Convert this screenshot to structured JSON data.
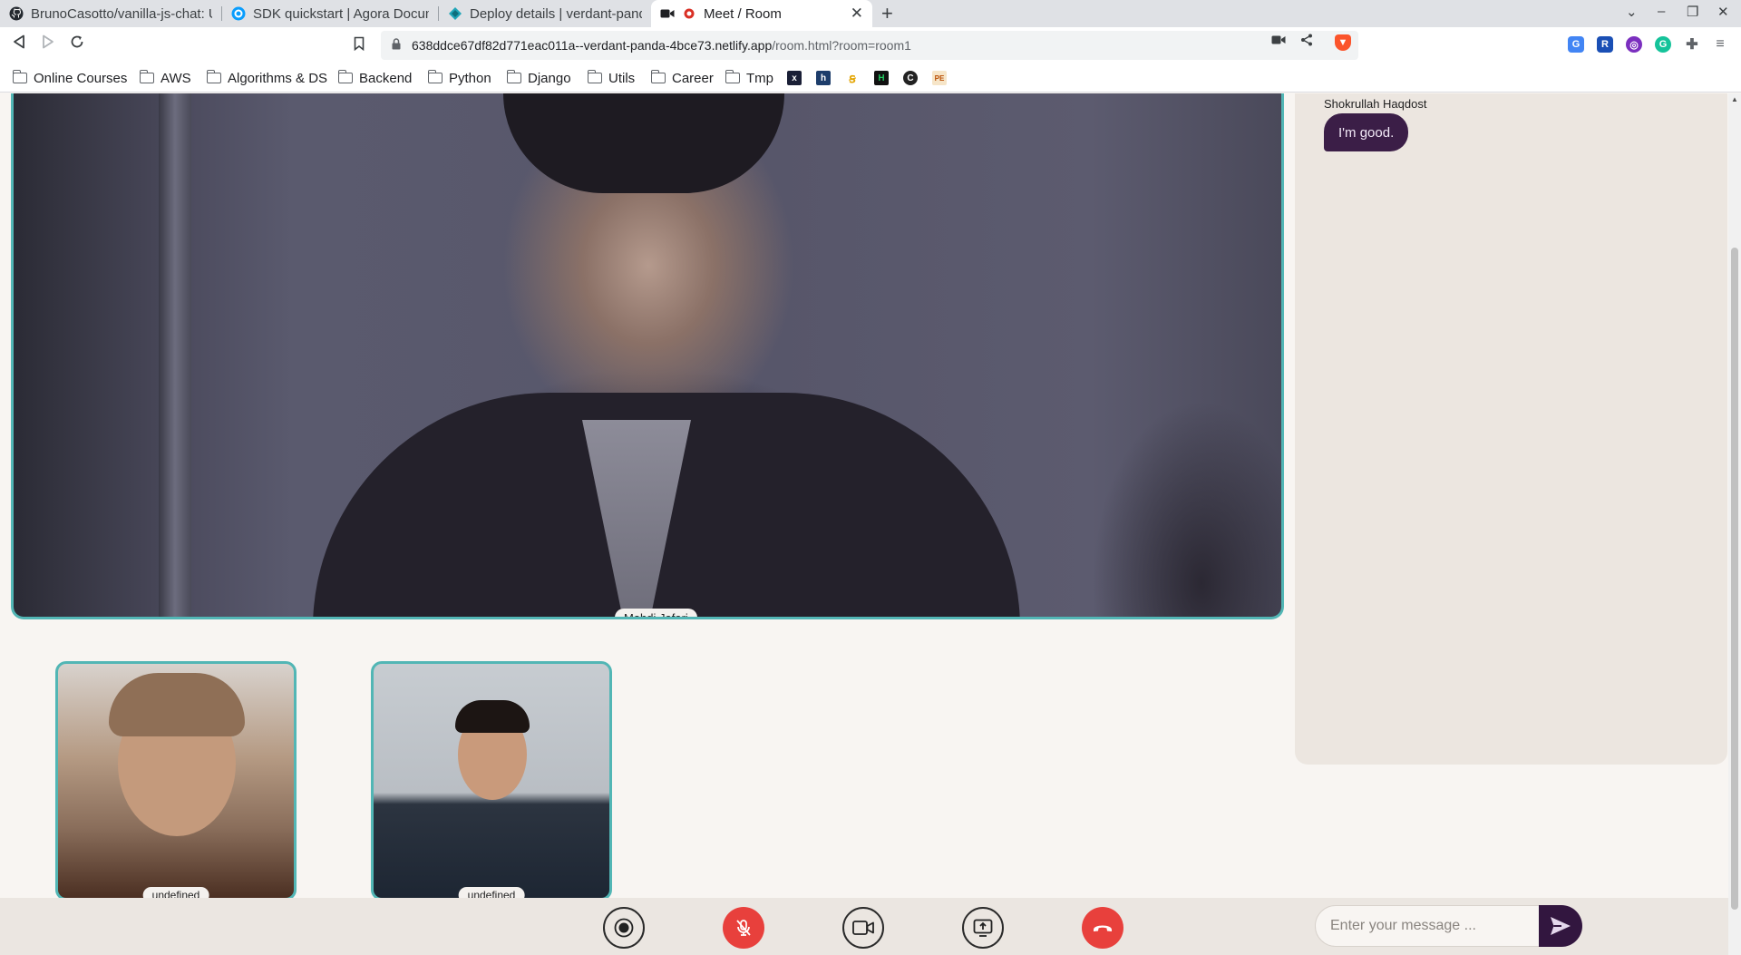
{
  "browser": {
    "tabs": [
      {
        "title": "BrunoCasotto/vanilla-js-chat: U",
        "icon": "github-icon"
      },
      {
        "title": "SDK quickstart | Agora Documen",
        "icon": "agora-icon"
      },
      {
        "title": "Deploy details | verdant-panda-",
        "icon": "netlify-icon"
      },
      {
        "title": "Meet / Room",
        "icon": "camera-icon",
        "active": true
      }
    ],
    "url_host": "638ddce67df82d771eac011a--verdant-panda-4bce73.netlify.app",
    "url_path": "/room.html?room=room1",
    "bookmarks": [
      "Online Courses",
      "AWS",
      "Algorithms & DS",
      "Backend",
      "Python",
      "Django",
      "Utils",
      "Career",
      "Tmp"
    ],
    "bookmark_icons": [
      "x",
      "h",
      "",
      "H",
      "C",
      "PE"
    ]
  },
  "room": {
    "main_speaker": "Mahdi Jafari",
    "participants": [
      {
        "name": "undefined"
      },
      {
        "name": "undefined"
      }
    ]
  },
  "chat": {
    "messages": [
      {
        "sender": "Shokrullah Haqdost",
        "text": "I'm good."
      }
    ],
    "input_placeholder": "Enter your message ..."
  },
  "colors": {
    "accent_border": "#52b6b5",
    "chat_bubble": "#3b1e47",
    "danger": "#e8403c",
    "send_button": "#32163f"
  }
}
